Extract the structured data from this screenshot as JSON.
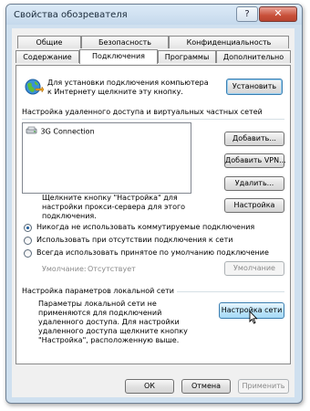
{
  "window": {
    "title": "Свойства обозревателя",
    "help": "?",
    "close": "✕"
  },
  "tabs_top": [
    "Общие",
    "Безопасность",
    "Конфиденциальность"
  ],
  "tabs_bottom": [
    "Содержание",
    "Подключения",
    "Программы",
    "Дополнительно"
  ],
  "connect": {
    "text": "Для установки подключения компьютера к Интернету щелкните эту кнопку.",
    "button": "Установить"
  },
  "dialup": {
    "heading": "Настройка удаленного доступа и виртуальных частных сетей",
    "items": [
      "3G Connection"
    ],
    "add": "Добавить...",
    "add_vpn": "Добавить VPN...",
    "remove": "Удалить...",
    "settings_text": "Щелкните кнопку \"Настройка\" для настройки прокси-сервера для этого подключения.",
    "settings": "Настройка",
    "options": [
      "Никогда не использовать коммутируемые подключения",
      "Использовать при отсутствии подключения к сети",
      "Всегда использовать принятое по умолчанию подключение"
    ],
    "selected_option": 0,
    "default_label": "Умолчание:",
    "default_value": "Отсутствует",
    "default_button": "Умолчание"
  },
  "lan": {
    "heading": "Настройка параметров локальной сети",
    "text": "Параметры локальной сети не применяются для подключений удаленного доступа. Для настройки удаленного доступа щелкните кнопку \"Настройка\", расположенную выше.",
    "button": "Настройка сети"
  },
  "footer": {
    "ok": "ОК",
    "cancel": "Отмена",
    "apply": "Применить"
  }
}
